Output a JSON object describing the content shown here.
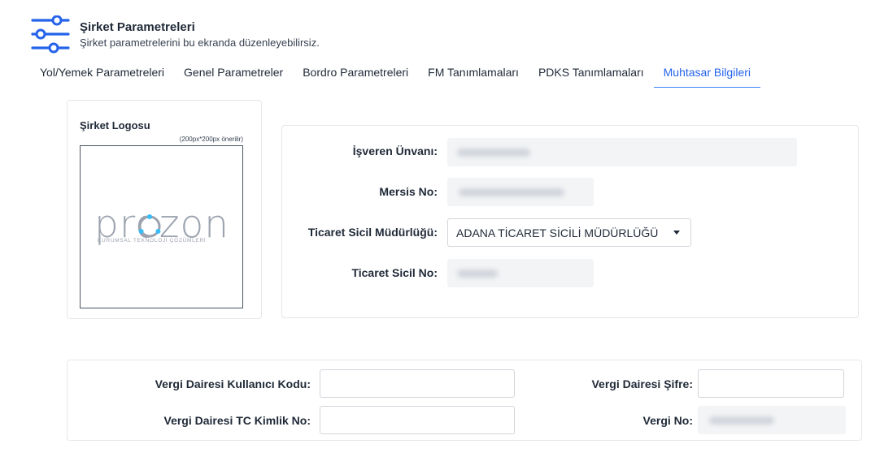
{
  "header": {
    "icon": "sliders-icon",
    "title": "Şirket Parametreleri",
    "subtitle": "Şirket parametrelerini bu ekranda düzenleyebilirsiz."
  },
  "tabs": [
    {
      "label": "Yol/Yemek Parametreleri",
      "active": false
    },
    {
      "label": "Genel Parametreler",
      "active": false
    },
    {
      "label": "Bordro Parametreleri",
      "active": false
    },
    {
      "label": "FM Tanımlamaları",
      "active": false
    },
    {
      "label": "PDKS Tanımlamaları",
      "active": false
    },
    {
      "label": "Muhtasar Bilgileri",
      "active": true
    }
  ],
  "logo": {
    "title": "Şirket Logosu",
    "hint": "(200px*200px önerilir)",
    "brand": "prozon",
    "tagline": "KURUMSAL TEKNOLOJİ ÇÖZÜMLERİ"
  },
  "company": {
    "employer_title_label": "İşveren Ünvanı:",
    "mersis_label": "Mersis No:",
    "registry_office_label": "Ticaret Sicil Müdürlüğü:",
    "registry_office_value": "ADANA TİCARET SİCİLİ MÜDÜRLÜĞÜ",
    "registry_no_label": "Ticaret Sicil No:"
  },
  "tax": {
    "username_label": "Vergi Dairesi Kullanıcı Kodu:",
    "username_value": "",
    "password_label": "Vergi Dairesi Şifre:",
    "password_value": "",
    "tc_label": "Vergi Dairesi TC Kimlik No:",
    "tc_value": "",
    "tax_no_label": "Vergi No:"
  },
  "colors": {
    "accent": "#2563eb",
    "border": "#e5e7eb"
  }
}
